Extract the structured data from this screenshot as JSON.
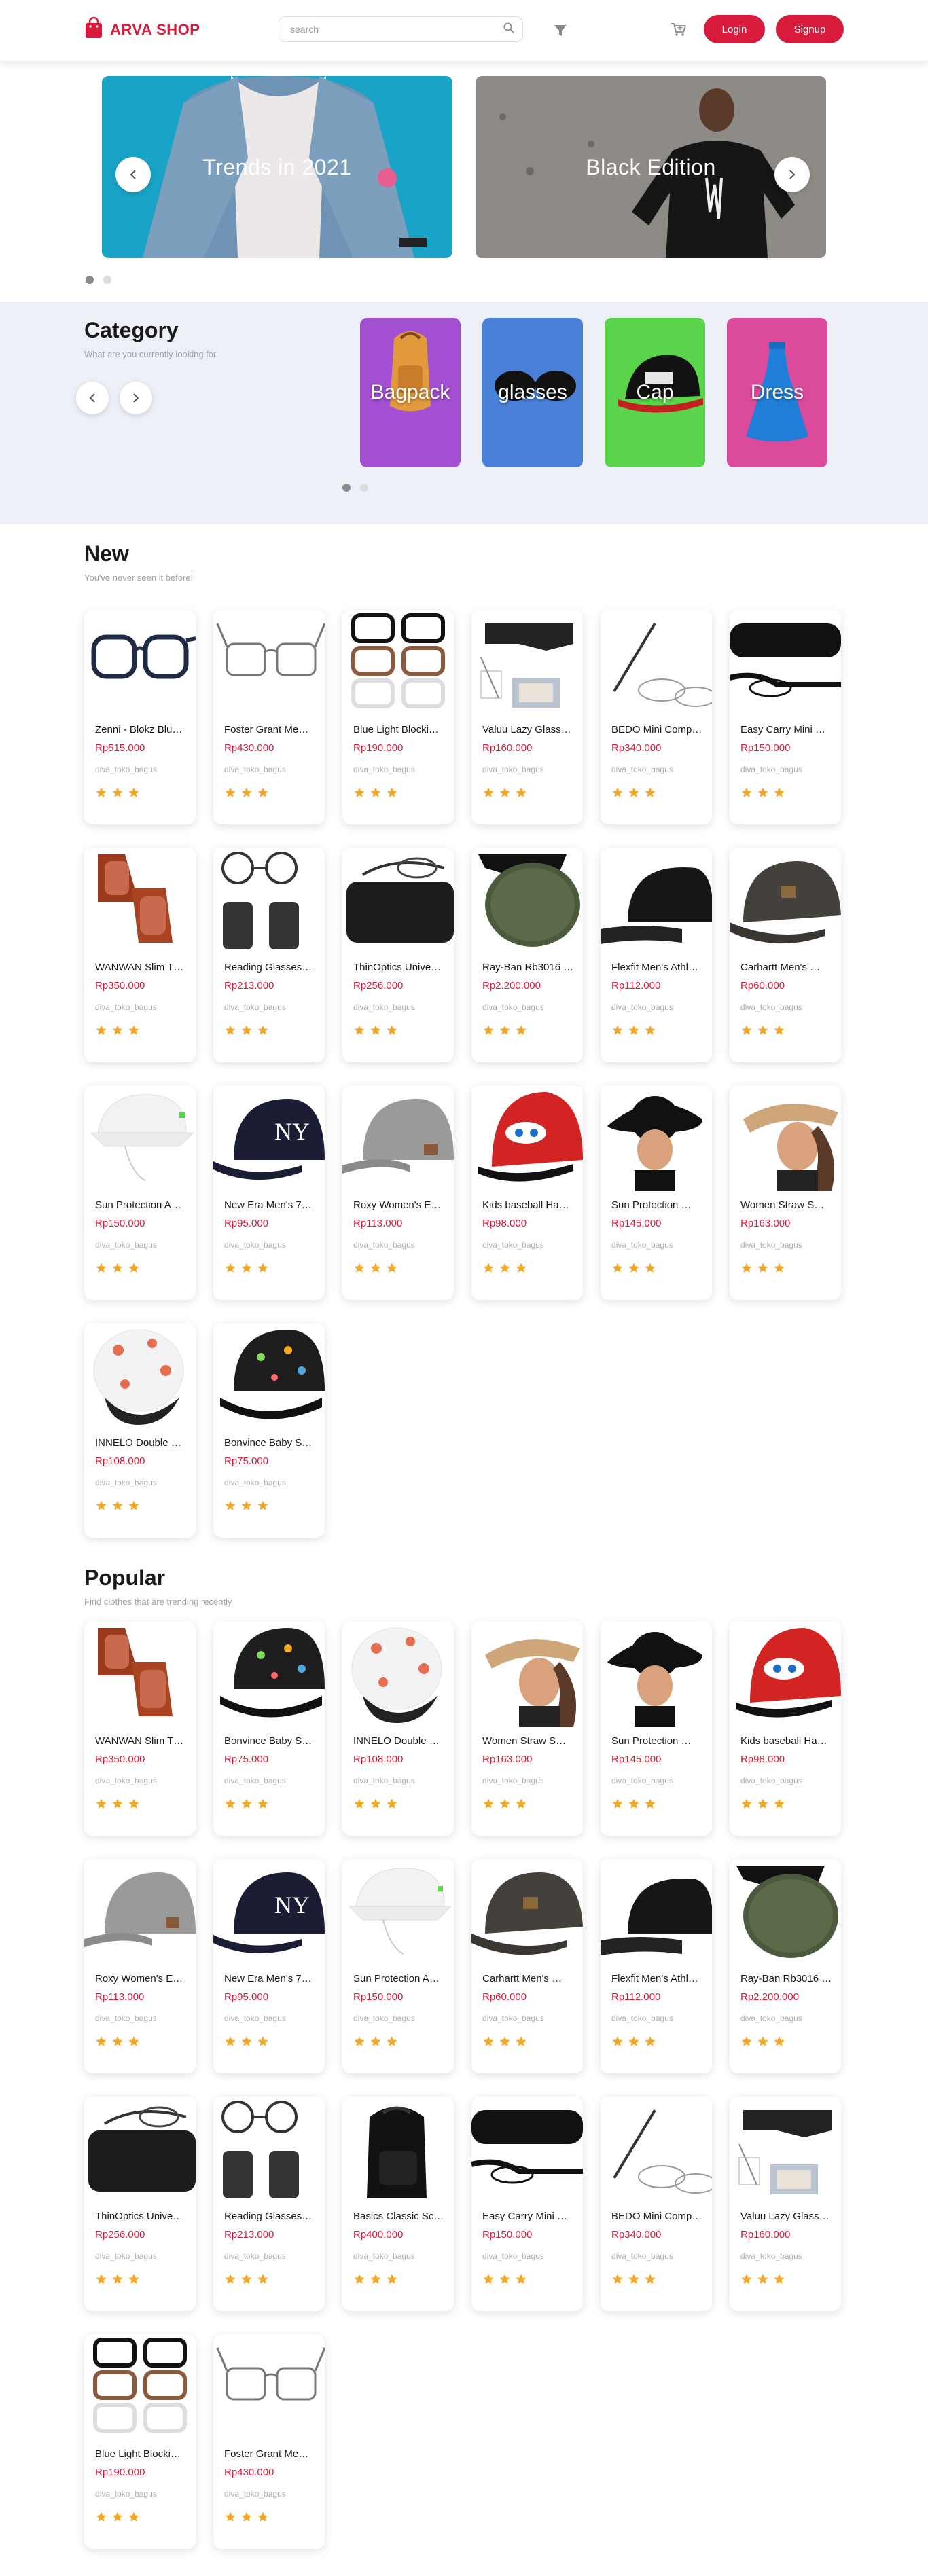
{
  "brand": {
    "name": "ARVA SHOP",
    "color": "#d81b3c"
  },
  "search": {
    "placeholder": "search"
  },
  "auth": {
    "login": "Login",
    "signup": "Signup"
  },
  "hero": {
    "slides": [
      {
        "title": "Trends in 2021",
        "image": "denim-jacket-photo"
      },
      {
        "title": "Black Edition",
        "image": "black-tshirt-photo"
      }
    ],
    "active_dot": 0
  },
  "category": {
    "title": "Category",
    "subtitle": "What are you currently looking for",
    "items": [
      {
        "label": "Bagpack",
        "color": "#a24fd1",
        "icon": "backpack"
      },
      {
        "label": "glasses",
        "color": "#4a80d8",
        "icon": "glasses"
      },
      {
        "label": "Cap",
        "color": "#5ad44a",
        "icon": "cap"
      },
      {
        "label": "Dress",
        "color": "#dc4a9c",
        "icon": "dress"
      }
    ],
    "active_dot": 0
  },
  "new_section": {
    "title": "New",
    "subtitle": "You've never seen it before!",
    "products": [
      {
        "name": "Zenni - Blokz Blu…",
        "price": "Rp515.000",
        "shop": "diva_toko_bagus",
        "image": "black-glasses"
      },
      {
        "name": "Foster Grant Me…",
        "price": "Rp430.000",
        "shop": "diva_toko_bagus",
        "image": "grey-glasses"
      },
      {
        "name": "Blue Light Blocki…",
        "price": "Rp190.000",
        "shop": "diva_toko_bagus",
        "image": "three-glasses"
      },
      {
        "name": "Valuu Lazy Glass…",
        "price": "Rp160.000",
        "shop": "diva_toko_bagus",
        "image": "lazy-glasses"
      },
      {
        "name": "BEDO Mini Comp…",
        "price": "Rp340.000",
        "shop": "diva_toko_bagus",
        "image": "thin-glasses"
      },
      {
        "name": "Easy Carry Mini …",
        "price": "Rp150.000",
        "shop": "diva_toko_bagus",
        "image": "glasses-case"
      },
      {
        "name": "WANWAN Slim T…",
        "price": "Rp350.000",
        "shop": "diva_toko_bagus",
        "image": "brown-glasses"
      },
      {
        "name": "Reading Glasses…",
        "price": "Rp213.000",
        "shop": "diva_toko_bagus",
        "image": "reading-glasses"
      },
      {
        "name": "ThinOptics Unive…",
        "price": "Rp256.000",
        "shop": "diva_toko_bagus",
        "image": "glasses-black-case"
      },
      {
        "name": "Ray-Ban Rb3016 …",
        "price": "Rp2.200.000",
        "shop": "diva_toko_bagus",
        "image": "rayban"
      },
      {
        "name": "Flexfit Men's Athl…",
        "price": "Rp112.000",
        "shop": "diva_toko_bagus",
        "image": "black-cap"
      },
      {
        "name": "Carhartt Men's …",
        "price": "Rp60.000",
        "shop": "diva_toko_bagus",
        "image": "grey-cap"
      },
      {
        "name": "Sun Protection A…",
        "price": "Rp150.000",
        "shop": "diva_toko_bagus",
        "image": "white-hat"
      },
      {
        "name": "New Era Men's 7…",
        "price": "Rp95.000",
        "shop": "diva_toko_bagus",
        "image": "ny-cap"
      },
      {
        "name": "Roxy Women's E…",
        "price": "Rp113.000",
        "shop": "diva_toko_bagus",
        "image": "light-grey-cap"
      },
      {
        "name": "Kids baseball Ha…",
        "price": "Rp98.000",
        "shop": "diva_toko_bagus",
        "image": "cars-cap"
      },
      {
        "name": "Sun Protection …",
        "price": "Rp145.000",
        "shop": "diva_toko_bagus",
        "image": "woman-black-hat"
      },
      {
        "name": "Women Straw S…",
        "price": "Rp163.000",
        "shop": "diva_toko_bagus",
        "image": "woman-visor"
      },
      {
        "name": "INNELO Double …",
        "price": "Rp108.000",
        "shop": "diva_toko_bagus",
        "image": "bonnet"
      },
      {
        "name": "Bonvince Baby S…",
        "price": "Rp75.000",
        "shop": "diva_toko_bagus",
        "image": "dino-cap"
      }
    ]
  },
  "popular_section": {
    "title": "Popular",
    "subtitle": "Find clothes that are trending recently",
    "products": [
      {
        "name": "WANWAN Slim T…",
        "price": "Rp350.000",
        "shop": "diva_toko_bagus",
        "image": "brown-glasses"
      },
      {
        "name": "Bonvince Baby S…",
        "price": "Rp75.000",
        "shop": "diva_toko_bagus",
        "image": "dino-cap"
      },
      {
        "name": "INNELO Double …",
        "price": "Rp108.000",
        "shop": "diva_toko_bagus",
        "image": "bonnet"
      },
      {
        "name": "Women Straw S…",
        "price": "Rp163.000",
        "shop": "diva_toko_bagus",
        "image": "woman-visor"
      },
      {
        "name": "Sun Protection …",
        "price": "Rp145.000",
        "shop": "diva_toko_bagus",
        "image": "woman-black-hat"
      },
      {
        "name": "Kids baseball Ha…",
        "price": "Rp98.000",
        "shop": "diva_toko_bagus",
        "image": "cars-cap"
      },
      {
        "name": "Roxy Women's E…",
        "price": "Rp113.000",
        "shop": "diva_toko_bagus",
        "image": "light-grey-cap"
      },
      {
        "name": "New Era Men's 7…",
        "price": "Rp95.000",
        "shop": "diva_toko_bagus",
        "image": "ny-cap"
      },
      {
        "name": "Sun Protection A…",
        "price": "Rp150.000",
        "shop": "diva_toko_bagus",
        "image": "white-hat"
      },
      {
        "name": "Carhartt Men's …",
        "price": "Rp60.000",
        "shop": "diva_toko_bagus",
        "image": "grey-cap"
      },
      {
        "name": "Flexfit Men's Athl…",
        "price": "Rp112.000",
        "shop": "diva_toko_bagus",
        "image": "black-cap"
      },
      {
        "name": "Ray-Ban Rb3016 …",
        "price": "Rp2.200.000",
        "shop": "diva_toko_bagus",
        "image": "rayban"
      },
      {
        "name": "ThinOptics Unive…",
        "price": "Rp256.000",
        "shop": "diva_toko_bagus",
        "image": "glasses-black-case"
      },
      {
        "name": "Reading Glasses…",
        "price": "Rp213.000",
        "shop": "diva_toko_bagus",
        "image": "reading-glasses"
      },
      {
        "name": "Basics Classic Sc…",
        "price": "Rp400.000",
        "shop": "diva_toko_bagus",
        "image": "backpack"
      },
      {
        "name": "Easy Carry Mini …",
        "price": "Rp150.000",
        "shop": "diva_toko_bagus",
        "image": "glasses-case"
      },
      {
        "name": "BEDO Mini Comp…",
        "price": "Rp340.000",
        "shop": "diva_toko_bagus",
        "image": "thin-glasses"
      },
      {
        "name": "Valuu Lazy Glass…",
        "price": "Rp160.000",
        "shop": "diva_toko_bagus",
        "image": "lazy-glasses"
      },
      {
        "name": "Blue Light Blocki…",
        "price": "Rp190.000",
        "shop": "diva_toko_bagus",
        "image": "three-glasses"
      },
      {
        "name": "Foster Grant Me…",
        "price": "Rp430.000",
        "shop": "diva_toko_bagus",
        "image": "grey-glasses"
      }
    ]
  },
  "rating_stars": 3,
  "star_color": "#f5a623"
}
